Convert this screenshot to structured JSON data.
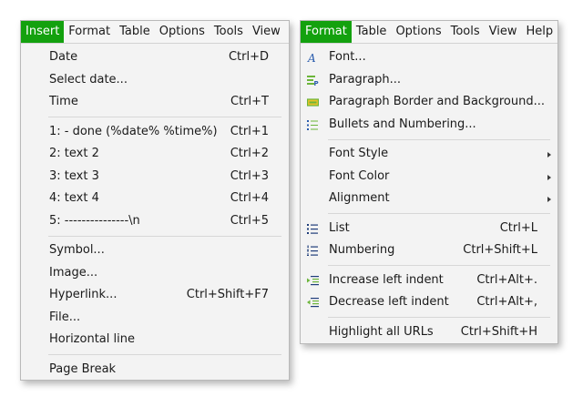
{
  "left_window": {
    "menubar": [
      "Insert",
      "Format",
      "Table",
      "Options",
      "Tools",
      "View"
    ],
    "active_menu": "Insert",
    "groups": [
      [
        {
          "label": "Date",
          "shortcut": "Ctrl+D"
        },
        {
          "label": "Select date...",
          "shortcut": ""
        },
        {
          "label": "Time",
          "shortcut": "Ctrl+T"
        }
      ],
      [
        {
          "label": "1:  - done (%date% %time%)",
          "shortcut": "Ctrl+1"
        },
        {
          "label": "2: text 2",
          "shortcut": "Ctrl+2"
        },
        {
          "label": "3: text 3",
          "shortcut": "Ctrl+3"
        },
        {
          "label": "4: text 4",
          "shortcut": "Ctrl+4"
        },
        {
          "label": "5: ---------------\\n",
          "shortcut": "Ctrl+5"
        }
      ],
      [
        {
          "label": "Symbol...",
          "shortcut": ""
        },
        {
          "label": "Image...",
          "shortcut": ""
        },
        {
          "label": "Hyperlink...",
          "shortcut": "Ctrl+Shift+F7"
        },
        {
          "label": "File...",
          "shortcut": ""
        },
        {
          "label": "Horizontal line",
          "shortcut": ""
        }
      ],
      [
        {
          "label": "Page Break",
          "shortcut": ""
        }
      ]
    ]
  },
  "right_window": {
    "menubar": [
      "Format",
      "Table",
      "Options",
      "Tools",
      "View",
      "Help"
    ],
    "active_menu": "Format",
    "groups": [
      [
        {
          "label": "Font...",
          "shortcut": "",
          "icon": "font-icon"
        },
        {
          "label": "Paragraph...",
          "shortcut": "",
          "icon": "paragraph-icon"
        },
        {
          "label": "Paragraph Border and Background...",
          "shortcut": "",
          "icon": "border-background-icon"
        },
        {
          "label": "Bullets and Numbering...",
          "shortcut": "",
          "icon": "bullets-numbering-icon"
        }
      ],
      [
        {
          "label": "Font Style",
          "shortcut": "",
          "submenu": true
        },
        {
          "label": "Font Color",
          "shortcut": "",
          "submenu": true
        },
        {
          "label": "Alignment",
          "shortcut": "",
          "submenu": true
        }
      ],
      [
        {
          "label": "List",
          "shortcut": "Ctrl+L",
          "icon": "list-icon"
        },
        {
          "label": "Numbering",
          "shortcut": "Ctrl+Shift+L",
          "icon": "numbering-icon"
        }
      ],
      [
        {
          "label": "Increase left indent",
          "shortcut": "Ctrl+Alt+.",
          "icon": "increase-indent-icon"
        },
        {
          "label": "Decrease left indent",
          "shortcut": "Ctrl+Alt+,",
          "icon": "decrease-indent-icon"
        }
      ],
      [
        {
          "label": "Highlight all URLs",
          "shortcut": "Ctrl+Shift+H"
        }
      ]
    ]
  },
  "colors": {
    "active_menu_bg": "#13a10e",
    "active_menu_text": "#ffffff",
    "menu_bg": "#f3f3f3",
    "icon_blue": "#2a5cad",
    "icon_green": "#6bb53a",
    "icon_yellow": "#e7c227"
  }
}
